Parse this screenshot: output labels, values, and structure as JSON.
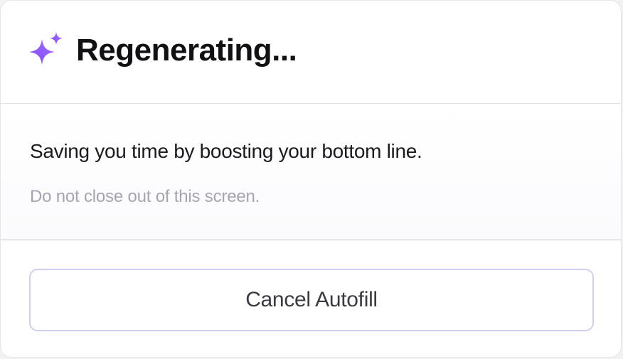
{
  "dialog": {
    "title": "Regenerating...",
    "icon": "sparkle-icon",
    "message": "Saving you time by boosting your bottom line.",
    "warning": "Do not close out of this screen.",
    "cancel_label": "Cancel Autofill"
  },
  "colors": {
    "accent": "#8b5cf6",
    "title": "#111114",
    "muted": "#a6a4b3",
    "button_border": "#cfcff0"
  }
}
